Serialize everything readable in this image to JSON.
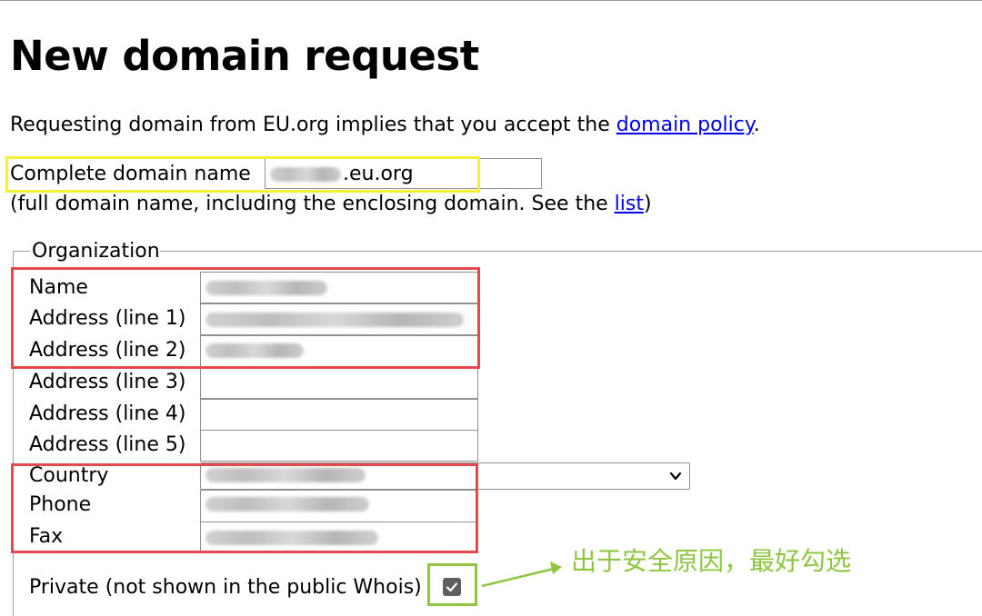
{
  "page": {
    "title": "New domain request",
    "intro_text": "Requesting domain from EU.org implies that you accept the ",
    "intro_link": "domain policy",
    "intro_end": "."
  },
  "domain": {
    "label": "Complete domain name",
    "value_suffix": ".eu.org",
    "hint_prefix": "(full domain name, including the enclosing domain. See the ",
    "hint_link": "list",
    "hint_suffix": ")"
  },
  "organization": {
    "legend": "Organization",
    "fields": {
      "name": "Name",
      "address1": "Address (line 1)",
      "address2": "Address (line 2)",
      "address3": "Address (line 3)",
      "address4": "Address (line 4)",
      "address5": "Address (line 5)",
      "country": "Country",
      "phone": "Phone",
      "fax": "Fax"
    },
    "private_label": "Private (not shown in the public Whois)",
    "private_checked": true
  },
  "annotation": {
    "text": "出于安全原因，最好勾选",
    "color": "#8ec63f"
  },
  "colors": {
    "link": "#0000ee",
    "highlight_yellow": "#f2f22e",
    "highlight_red": "#e5484d",
    "highlight_green": "#8ec63f"
  }
}
